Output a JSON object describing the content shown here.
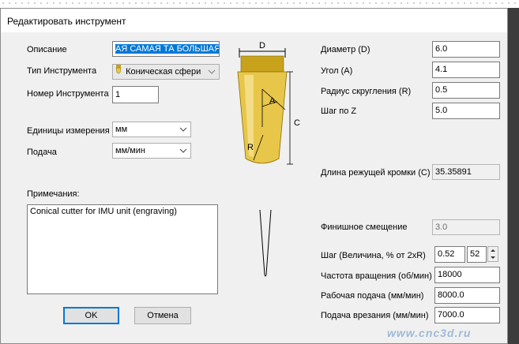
{
  "window": {
    "title": "Редактировать инструмент"
  },
  "left": {
    "description_label": "Описание",
    "description_value": "АЯ САМАЯ ТА БОЛЬШАЯ",
    "tool_type_label": "Тип Инструмента",
    "tool_type_value": "Коническая сфери",
    "tool_number_label": "Номер Инструмента",
    "tool_number_value": "1",
    "units_label": "Единицы измерения",
    "units_value": "мм",
    "feed_label": "Подача",
    "feed_value": "мм/мин",
    "notes_label": "Примечания:",
    "notes_value": "Conical cutter for IMU unit (engraving)"
  },
  "diagram": {
    "d_label": "D",
    "a_label": "A",
    "c_label": "C",
    "r_label": "R"
  },
  "right": {
    "diameter_label": "Диаметр (D)",
    "diameter_value": "6.0",
    "angle_label": "Угол (A)",
    "angle_value": "4.1",
    "radius_label": "Радиус скругления (R)",
    "radius_value": "0.5",
    "stepz_label": "Шаг по Z",
    "stepz_value": "5.0",
    "cutlen_label": "Длина режущей кромки (C)",
    "cutlen_value": "35.35891",
    "finish_label": "Финишное смещение",
    "finish_value": "3.0",
    "step_label": "Шаг (Величина, % от 2xR)",
    "step_value": "0.52",
    "step_percent": "52",
    "rpm_label": "Частота вращения (об/мин)",
    "rpm_value": "18000",
    "feedrate_label": "Рабочая подача (мм/мин)",
    "feedrate_value": "8000.0",
    "plunge_label": "Подача врезания (мм/мин)",
    "plunge_value": "7000.0"
  },
  "buttons": {
    "ok": "OK",
    "cancel": "Отмена"
  },
  "watermark": "www.cnc3d.ru",
  "colors": {
    "tool_gold": "#e8c64a",
    "tool_shank": "#c9a21c",
    "accent": "#0078d7"
  },
  "icons": {
    "tool_type": "tool-bit-icon",
    "dropdown": "chevron-down-icon",
    "spin_up": "triangle-up-icon",
    "spin_down": "triangle-down-icon"
  }
}
